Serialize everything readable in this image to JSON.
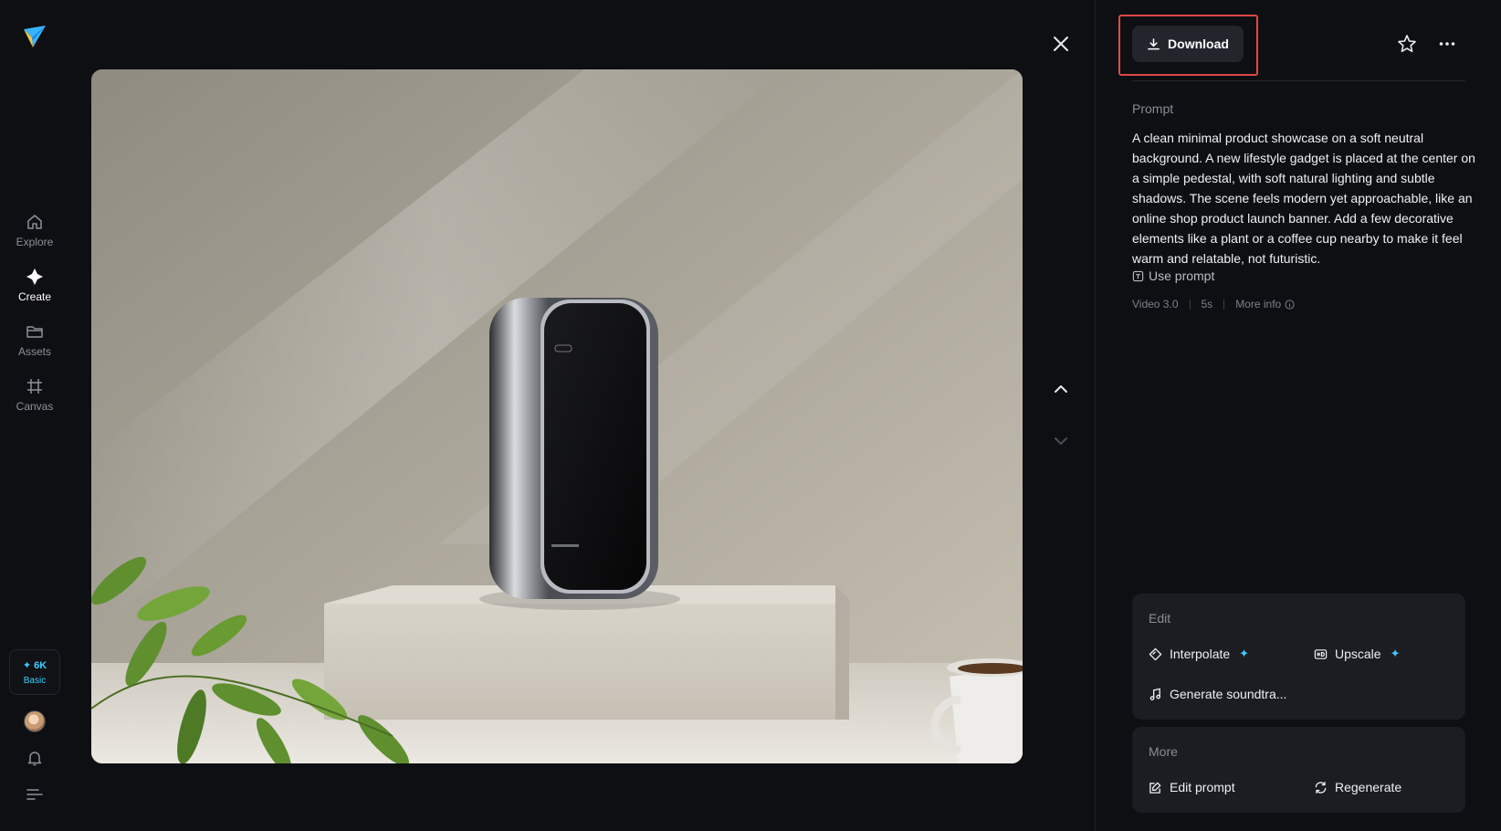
{
  "sidebar": {
    "items": [
      {
        "label": "Explore",
        "icon": "home-icon",
        "active": false
      },
      {
        "label": "Create",
        "icon": "sparkle-icon",
        "active": true
      },
      {
        "label": "Assets",
        "icon": "folder-icon",
        "active": false
      },
      {
        "label": "Canvas",
        "icon": "canvas-icon",
        "active": false
      }
    ],
    "credits": {
      "amount": "✦ 6K",
      "plan": "Basic"
    }
  },
  "toolbar": {
    "download_label": "Download"
  },
  "prompt": {
    "label": "Prompt",
    "text": "A clean minimal product showcase on a soft neutral background. A new lifestyle gadget is placed at the center on a simple pedestal, with soft natural lighting and subtle shadows. The scene feels modern yet approachable, like an online shop product launch banner. Add a few decorative elements like a plant or a coffee cup nearby to make it feel warm and relatable, not futuristic.",
    "use_prompt": "Use prompt"
  },
  "meta": {
    "model": "Video 3.0",
    "duration": "5s",
    "more_info": "More info"
  },
  "edit": {
    "title": "Edit",
    "interpolate": "Interpolate",
    "upscale": "Upscale",
    "soundtrack": "Generate soundtra..."
  },
  "more": {
    "title": "More",
    "edit_prompt": "Edit prompt",
    "regenerate": "Regenerate"
  },
  "colors": {
    "accent": "#3ec9ff",
    "highlight": "#e04848",
    "background": "#0e0f13"
  }
}
